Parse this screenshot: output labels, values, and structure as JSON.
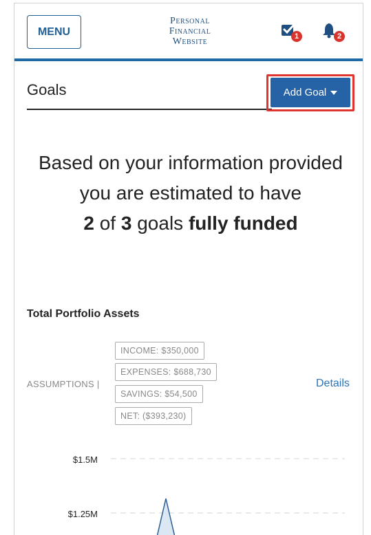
{
  "header": {
    "menu_label": "MENU",
    "brand_line1": "Personal",
    "brand_line2": "Financial",
    "brand_line3": "Website",
    "tasks_badge": "1",
    "notifications_badge": "2"
  },
  "goals": {
    "title": "Goals",
    "add_goal_label": "Add Goal"
  },
  "summary": {
    "line1": "Based on your information provided you are estimated to have",
    "funded_count": "2",
    "of_word": "of",
    "total_count": "3",
    "goals_word": "goals",
    "funded_phrase": "fully funded"
  },
  "portfolio": {
    "title": "Total Portfolio Assets",
    "assumptions_label": "ASSUMPTIONS |",
    "income": "INCOME: $350,000",
    "expenses": "EXPENSES: $688,730",
    "savings": "SAVINGS: $54,500",
    "net": "NET: ($393,230)",
    "details_label": "Details"
  },
  "chart_data": {
    "type": "area",
    "title": "",
    "xlabel": "",
    "ylabel": "",
    "y_ticks": [
      "$1.5M",
      "$1.25M"
    ],
    "grid": true
  },
  "colors": {
    "accent": "#1f6aa5",
    "button": "#2563a6",
    "highlight": "#e0342e",
    "badge": "#d9342b",
    "link": "#2b73b8"
  }
}
